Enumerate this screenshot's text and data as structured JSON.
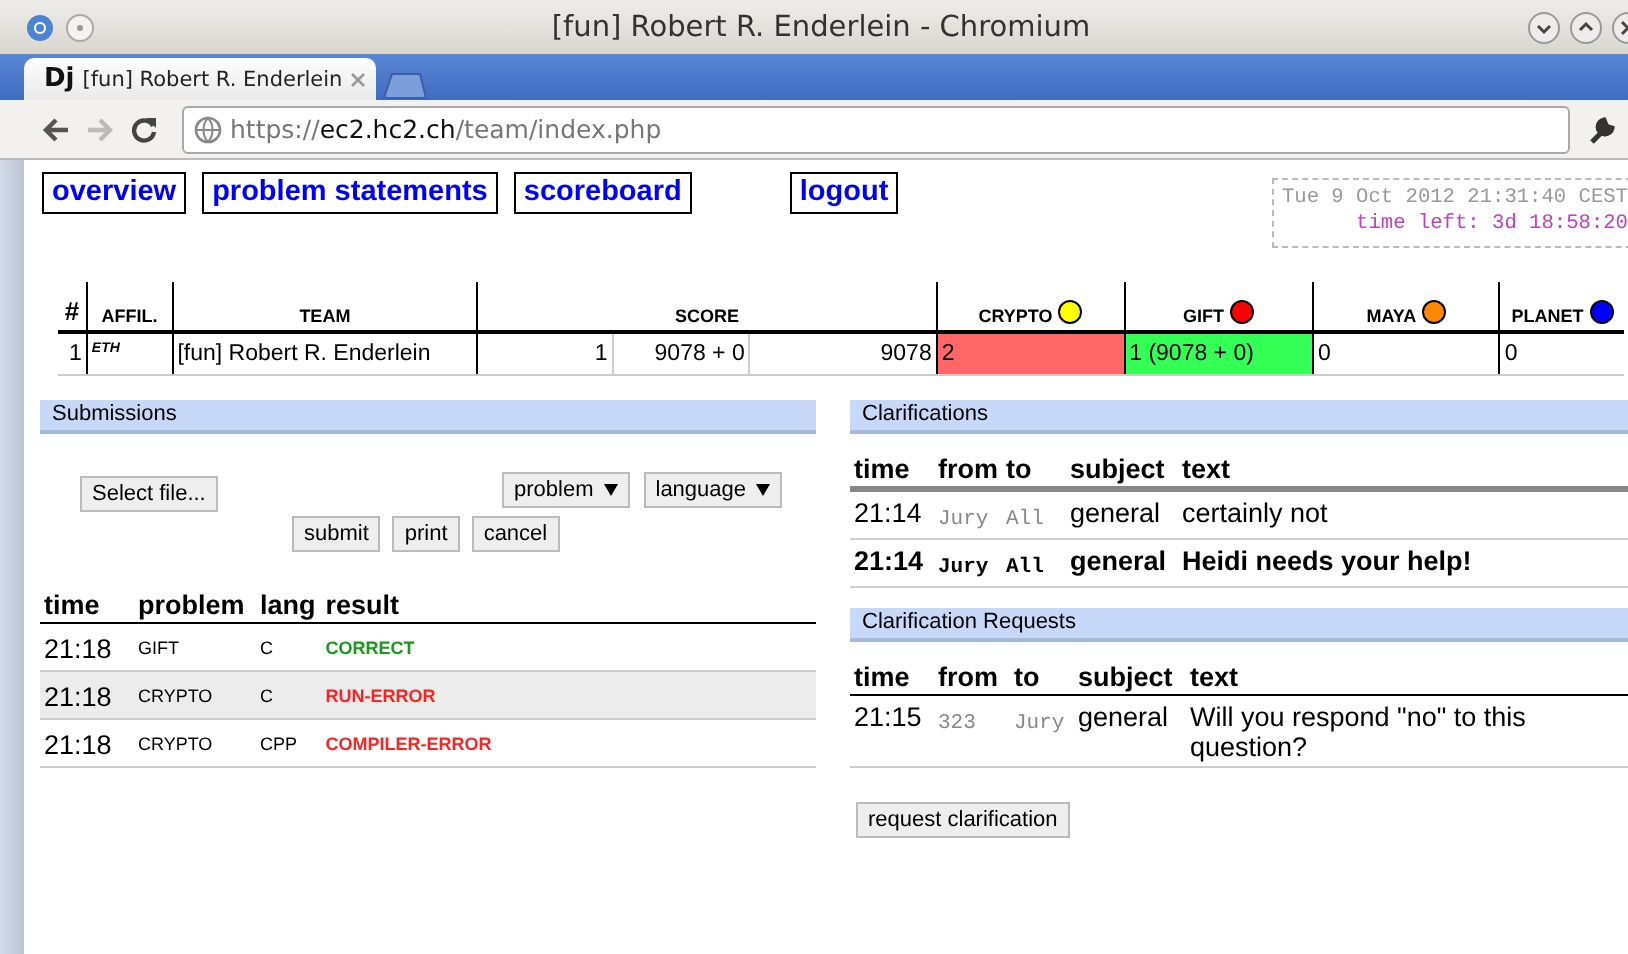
{
  "window": {
    "title": "[fun] Robert R. Enderlein - Chromium"
  },
  "tab": {
    "logo": "Dj",
    "label": "[fun] Robert R. Enderlein"
  },
  "address_bar": {
    "scheme": "https://",
    "host": "ec2.hc2.ch",
    "path": "/team/index.php"
  },
  "nav": [
    {
      "label": "overview"
    },
    {
      "label": "problem statements"
    },
    {
      "label": "scoreboard"
    }
  ],
  "logout": "logout",
  "clock": {
    "time": "Tue 9 Oct 2012 21:31:40 CEST",
    "time_left": "time left: 3d 18:58:20"
  },
  "scoreboard": {
    "columns": [
      "#",
      "AFFIL.",
      "TEAM",
      "SCORE"
    ],
    "problems": [
      {
        "name": "CRYPTO",
        "color": "#ffff00"
      },
      {
        "name": "GIFT",
        "color": "#ff0000"
      },
      {
        "name": "MAYA",
        "color": "#ff8800"
      },
      {
        "name": "PLANET",
        "color": "#0000ff"
      }
    ],
    "row": {
      "rank": "1",
      "affiliation": "ETH",
      "team": "[fun] Robert R. Enderlein",
      "solved": "1",
      "penalty": "9078 + 0",
      "total": "9078",
      "cells": [
        {
          "text": "2",
          "kind": "incorrect"
        },
        {
          "text": "1 (9078 + 0)",
          "kind": "correct"
        },
        {
          "text": "0",
          "kind": "untried"
        },
        {
          "text": "0",
          "kind": "untried"
        }
      ]
    }
  },
  "submissions": {
    "title": "Submissions",
    "file_button": "Select file...",
    "problem_select": "problem",
    "language_select": "language",
    "buttons": [
      "submit",
      "print",
      "cancel"
    ],
    "columns": [
      "time",
      "problem",
      "lang",
      "result"
    ],
    "rows": [
      {
        "time": "21:18",
        "problem": "GIFT",
        "lang": "C",
        "result": "CORRECT",
        "correct": true,
        "highlighted": false
      },
      {
        "time": "21:18",
        "problem": "CRYPTO",
        "lang": "C",
        "result": "RUN-ERROR",
        "correct": false,
        "highlighted": true
      },
      {
        "time": "21:18",
        "problem": "CRYPTO",
        "lang": "CPP",
        "result": "COMPILER-ERROR",
        "correct": false,
        "highlighted": false
      }
    ]
  },
  "clarifications": {
    "title": "Clarifications",
    "columns": [
      "time",
      "from",
      "to",
      "subject",
      "text"
    ],
    "rows": [
      {
        "time": "21:14",
        "from": "Jury",
        "to": "All",
        "subject": "general",
        "text": "certainly not",
        "unread": false
      },
      {
        "time": "21:14",
        "from": "Jury",
        "to": "All",
        "subject": "general",
        "text": "Heidi needs your help!",
        "unread": true
      }
    ]
  },
  "clarification_requests": {
    "title": "Clarification Requests",
    "columns": [
      "time",
      "from",
      "to",
      "subject",
      "text"
    ],
    "rows": [
      {
        "time": "21:15",
        "from": "323",
        "to": "Jury",
        "subject": "general",
        "text": "Will you respond \"no\" to this question?",
        "unread": false
      }
    ],
    "button": "request clarification"
  }
}
